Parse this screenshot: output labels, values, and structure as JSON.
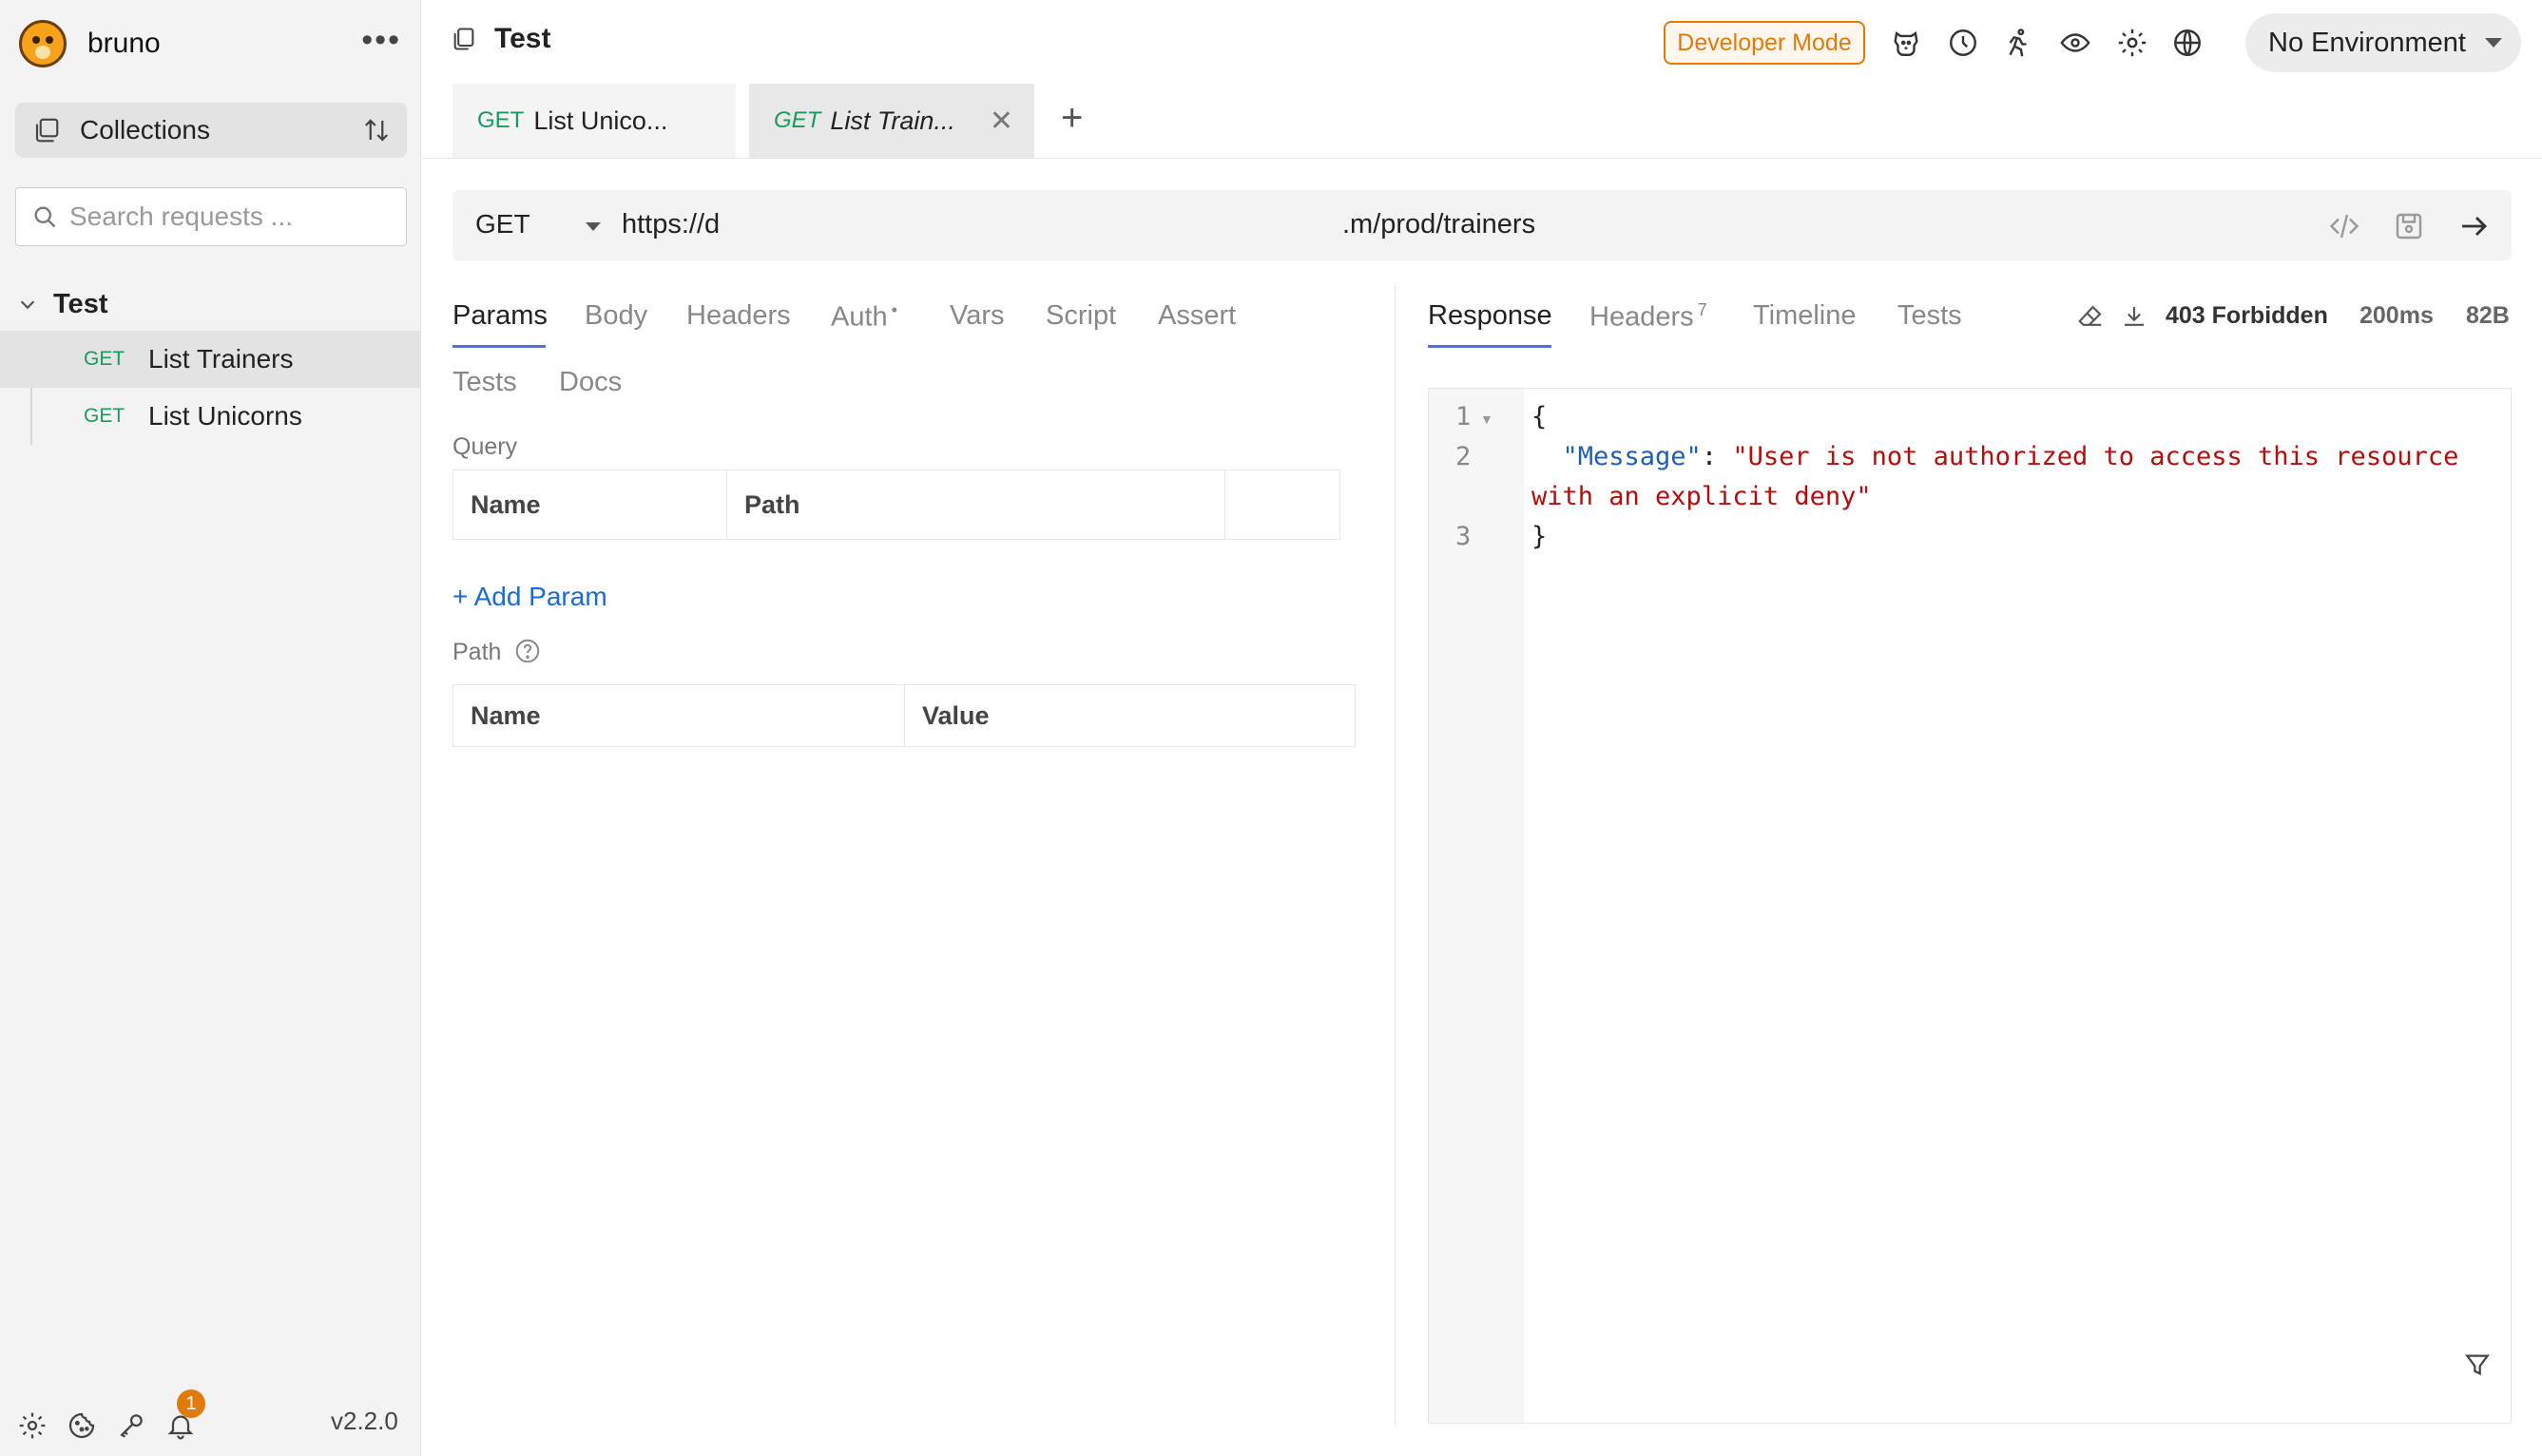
{
  "app": {
    "name": "bruno",
    "version": "v2.2.0",
    "notification_count": "1"
  },
  "sidebar": {
    "collections_label": "Collections",
    "search_placeholder": "Search requests ...",
    "collection_name": "Test",
    "items": [
      {
        "method": "GET",
        "label": "List Trainers",
        "active": true
      },
      {
        "method": "GET",
        "label": "List Unicorns",
        "active": false
      }
    ]
  },
  "header": {
    "workspace_title": "Test",
    "developer_mode_label": "Developer Mode",
    "environment_label": "No Environment"
  },
  "tabs": [
    {
      "method": "GET",
      "label": "List Unico..."
    },
    {
      "method": "GET",
      "label": "List Train..."
    }
  ],
  "request": {
    "method": "GET",
    "url_start": "https://d",
    "url_end": ".m/prod/trainers",
    "tabs": [
      "Params",
      "Body",
      "Headers",
      "Auth",
      "Vars",
      "Script",
      "Assert",
      "Tests",
      "Docs"
    ],
    "auth_marker": "•",
    "query_label": "Query",
    "query_columns": [
      "Name",
      "Path"
    ],
    "add_param_label": "+ Add Param",
    "path_label": "Path",
    "path_columns": [
      "Name",
      "Value"
    ]
  },
  "response": {
    "tabs": [
      "Response",
      "Headers",
      "Timeline",
      "Tests"
    ],
    "headers_count": "7",
    "status": "403 Forbidden",
    "time": "200ms",
    "size": "82B",
    "lines": [
      "1",
      "2",
      "3"
    ],
    "code": {
      "open_brace": "{",
      "key": "\"Message\"",
      "colon": ": ",
      "value_line1": "\"User is not authorized to access this resource",
      "value_line2": "with an explicit deny\"",
      "close_brace": "}"
    }
  },
  "colors": {
    "accent": "#546de5",
    "method_get": "#1a9b5c",
    "developer_mode": "#e07b0a",
    "json_key": "#1f5fb0",
    "json_string": "#b30d0d"
  }
}
